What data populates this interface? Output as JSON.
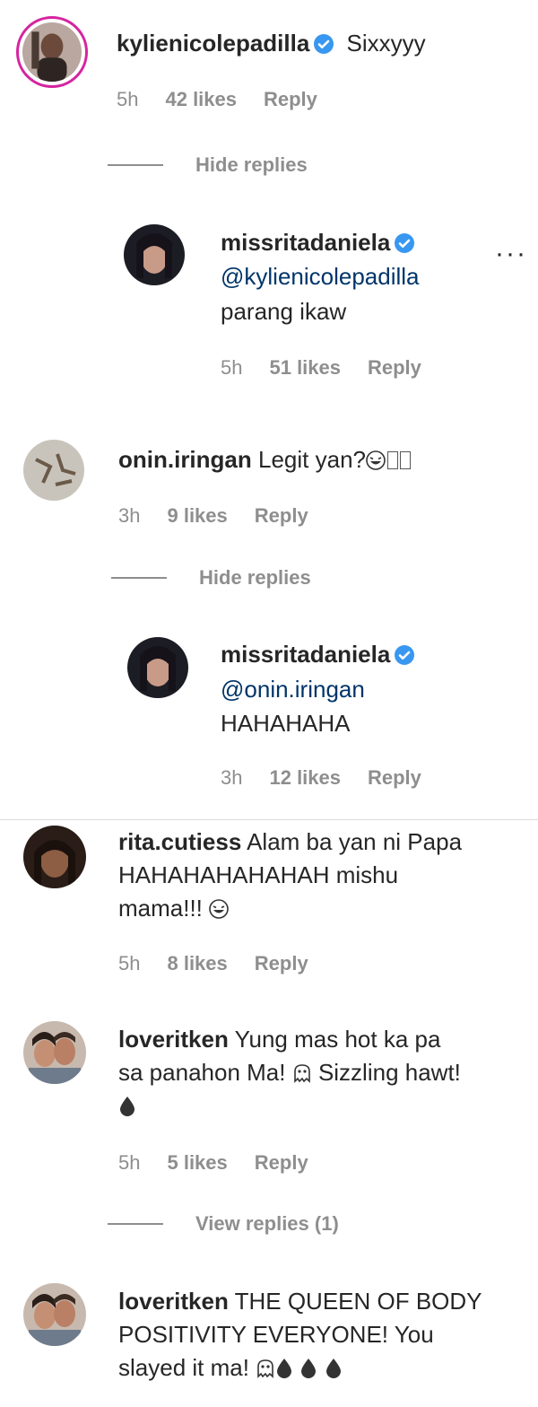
{
  "comments": [
    {
      "username": "kylienicolepadilla",
      "text": "Sixxyyy",
      "time": "5h",
      "likes": "42 likes",
      "reply": "Reply",
      "toggle": "Hide replies",
      "replies": [
        {
          "username": "missritadaniela",
          "mention": "@kylienicolepadilla",
          "text": "parang ikaw",
          "time": "5h",
          "likes": "51 likes",
          "reply": "Reply"
        }
      ]
    },
    {
      "username": "onin.iringan",
      "text": "Legit yan?",
      "time": "3h",
      "likes": "9 likes",
      "reply": "Reply",
      "toggle": "Hide replies",
      "replies": [
        {
          "username": "missritadaniela",
          "mention": "@onin.iringan",
          "text": "HAHAHAHA",
          "time": "3h",
          "likes": "12 likes",
          "reply": "Reply"
        }
      ]
    },
    {
      "username": "rita.cutiess",
      "text_line1": "Alam ba yan ni Papa",
      "text_line2": "HAHAHAHAHAHAH mishu",
      "text_line3": "mama!!!",
      "time": "5h",
      "likes": "8 likes",
      "reply": "Reply"
    },
    {
      "username": "loveritken",
      "text_line1": "Yung mas hot ka pa",
      "text_line2": "sa panahon Ma!",
      "text_line2b": "Sizzling hawt!",
      "time": "5h",
      "likes": "5 likes",
      "reply": "Reply",
      "toggle": "View replies (1)"
    },
    {
      "username": "loveritken",
      "text_line1": "THE QUEEN OF BODY",
      "text_line2": "POSITIVITY EVERYONE! You",
      "text_line3": "slayed it ma!"
    }
  ],
  "icons": {
    "verified": "verified-badge-icon",
    "more": "more-options-icon",
    "laughing": "laughing-emoji-icon",
    "ghost": "ghost-emoji-icon",
    "drop": "drop-emoji-icon"
  },
  "colors": {
    "text": "#262626",
    "meta": "#8e8e8e",
    "mention": "#003569",
    "verified": "#3897f0",
    "ring": "#d6249f"
  }
}
